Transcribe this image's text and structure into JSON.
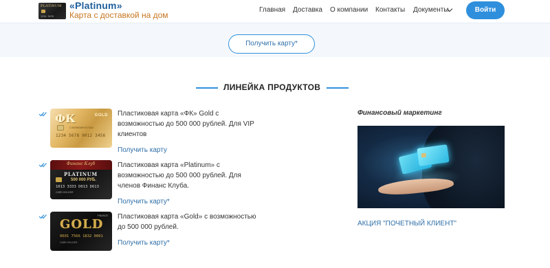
{
  "header": {
    "brand_title": "«Platinum»",
    "brand_subtitle": "Карта с доставкой на дом",
    "nav": [
      "Главная",
      "Доставка",
      "О компании",
      "Контакты",
      "Документы"
    ],
    "login_label": "Войти",
    "logo_text": "PLATINUM",
    "logo_number": "1234 5678"
  },
  "hero": {
    "cta_label": "Получить карту*"
  },
  "products_section": {
    "title": "ЛИНЕЙКА ПРОДУКТОВ",
    "items": [
      {
        "card": {
          "big": "ФК",
          "tag": "GOLD",
          "number": "1234 5678 9012 3456",
          "sub": "С ВОЗМОЖНОСТЬЮ"
        },
        "description": "Пластиковая карта «ФК» Gold с возможностью до 500 000 рублей. Для VIP клиентов",
        "link": "Получить карту"
      },
      {
        "card": {
          "script": "Финанс Клуб",
          "word": "PLATINUM",
          "price": "500 000 РУБ.",
          "number": "1013 3333 D013 D613",
          "name": "CARD HOLDER"
        },
        "description": "Пластиковая карта «Platinum» с возможностью до 500 000 рублей. Для членов Финанс Клуба.",
        "link": "Получить карту*"
      },
      {
        "card": {
          "word": "GOLD",
          "number": "0601 7566 1832 0001",
          "small": "FINANCE",
          "name": "CARD HOLDER"
        },
        "description": "Пластиковая карта «Gold» с возможностью до 500 000 рублей.",
        "link": "Получить карту*"
      }
    ]
  },
  "sidebar": {
    "title": "Финансовый маркетинг",
    "promo_link": "АКЦИЯ \"ПОЧЕТНЫЙ КЛИЕНТ\""
  },
  "colors": {
    "accent": "#2f8fdc",
    "brand": "#1e5f9c",
    "subtitle": "#c7751e",
    "link": "#2f6fa8"
  }
}
